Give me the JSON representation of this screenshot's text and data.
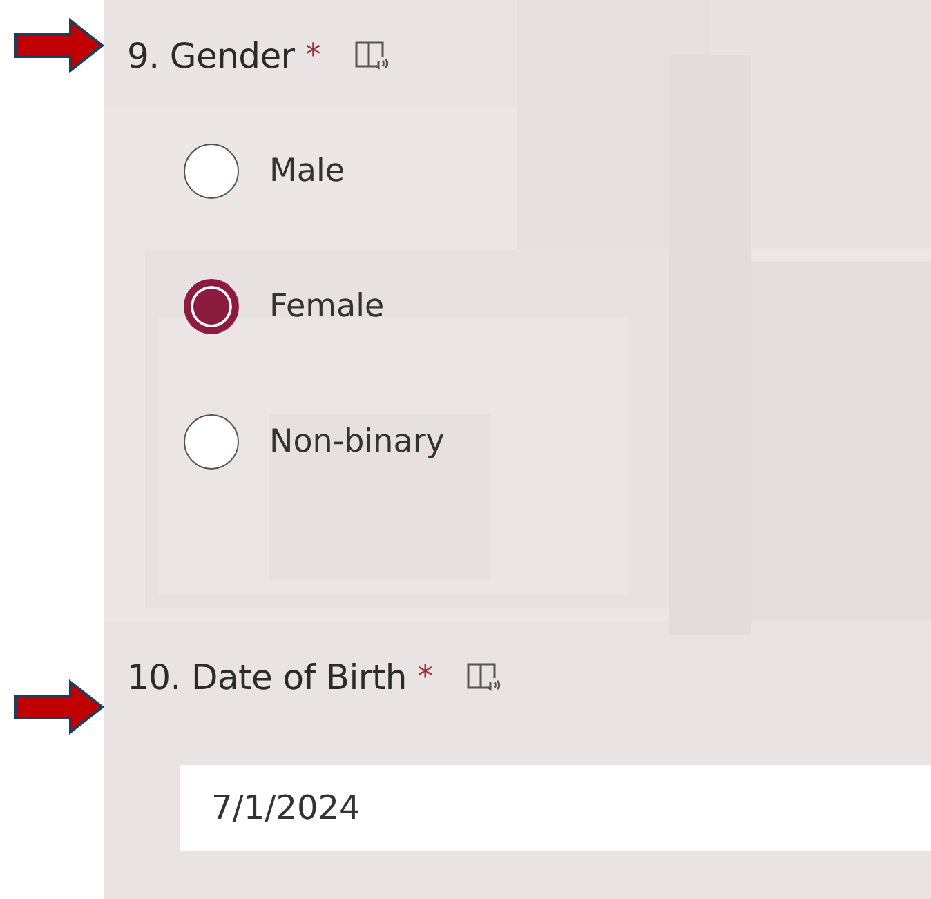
{
  "questions": [
    {
      "kind": "choice",
      "number": "9.",
      "title": "Gender",
      "required_mark": "*",
      "marked": true,
      "options": [
        {
          "label": "Male",
          "selected": false
        },
        {
          "label": "Female",
          "selected": true
        },
        {
          "label": "Non-binary",
          "selected": false
        }
      ]
    },
    {
      "kind": "date",
      "number": "10.",
      "title": "Date of Birth",
      "required_mark": "*",
      "marked": true,
      "value": "7/1/2024"
    }
  ]
}
